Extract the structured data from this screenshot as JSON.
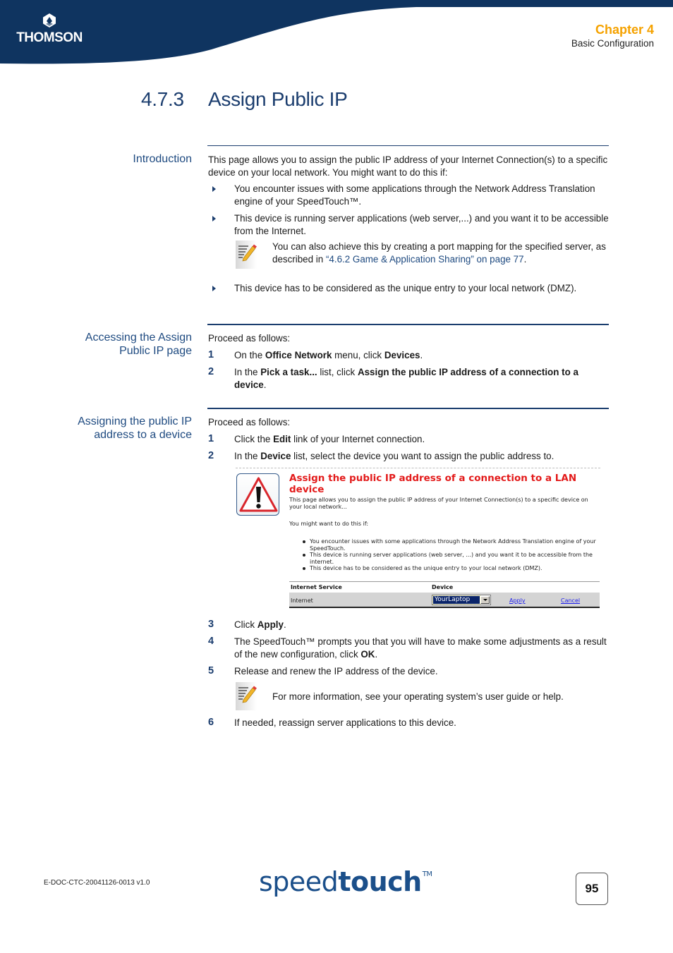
{
  "header": {
    "brand": "THOMSON",
    "chapter_title": "Chapter 4",
    "chapter_subtitle": "Basic Configuration",
    "colors": {
      "band": "#0f3460",
      "chapter_accent": "#f5a200",
      "heading": "#1b3d6e"
    }
  },
  "page_title": {
    "number": "4.7.3",
    "text": "Assign Public IP"
  },
  "sections": {
    "introduction": {
      "heading": "Introduction",
      "intro": "This page allows you to assign the public IP address of your Internet Connection(s) to a specific device on your local network. You might want to do this if:",
      "bullets": [
        "You encounter issues with some applications through the Network Address Translation engine of your SpeedTouch™.",
        "This device is running server applications (web server,...) and you want it to be accessible from the Internet.",
        "This device has to be considered as the unique entry to your local network (DMZ)."
      ],
      "note": {
        "text_before": "You can also achieve this by creating a port mapping for the specified server, as described in ",
        "link_text": "“4.6.2 Game & Application Sharing” on page 77",
        "text_after": "."
      }
    },
    "accessing": {
      "heading_line1": "Accessing the Assign",
      "heading_line2": "Public IP page",
      "lead": "Proceed as follows:",
      "steps": [
        {
          "num": "1",
          "parts": [
            "On the ",
            "Office Network",
            " menu, click ",
            "Devices",
            "."
          ]
        },
        {
          "num": "2",
          "parts": [
            "In the ",
            "Pick a task...",
            " list, click ",
            "Assign the public IP address of a connection to a device",
            "."
          ]
        }
      ]
    },
    "assigning": {
      "heading_line1": "Assigning the public IP",
      "heading_line2": "address to a device",
      "lead": "Proceed as follows:",
      "steps": [
        {
          "num": "1",
          "parts": [
            "Click the ",
            "Edit",
            " link of your Internet connection."
          ]
        },
        {
          "num": "2",
          "parts": [
            "In the ",
            "Device",
            " list, select the device you want to assign the public address to."
          ]
        },
        {
          "num": "3",
          "parts": [
            "Click ",
            "Apply",
            "."
          ]
        },
        {
          "num": "4",
          "parts": [
            "The SpeedTouch™ prompts you that you will have to make some adjustments as a result of the new configuration, click ",
            "OK",
            "."
          ]
        },
        {
          "num": "5",
          "parts": [
            "Release and renew the IP address of the device."
          ]
        },
        {
          "num": "6",
          "parts": [
            "If needed, reassign server applications to this device."
          ]
        }
      ],
      "note": "For more information, see your operating system’s user guide or help."
    }
  },
  "screenshot": {
    "title": "Assign the public IP address of a connection to a LAN device",
    "description": "This page allows you to assign the public IP address of your Internet Connection(s) to a specific device on your local network...",
    "lead": "You might want to do this if:",
    "bullets": [
      "You encounter issues with some applications through the Network Address Translation engine of your SpeedTouch.",
      "This device is running server applications (web server, ...) and you want it to be accessible from the internet.",
      "This device has to be considered as the unique entry to your local network (DMZ)."
    ],
    "table": {
      "col_service": "Internet Service",
      "col_device": "Device",
      "row_service": "Internet",
      "device_selected": "YourLaptop",
      "apply_label": "Apply",
      "cancel_label": "Cancel"
    },
    "colors": {
      "title": "#e31b1b",
      "row_bg": "#d4d4d4",
      "select_highlight": "#0a246a",
      "link": "#1a1aee"
    }
  },
  "footer": {
    "doc_id": "E-DOC-CTC-20041126-0013 v1.0",
    "logo_light": "speed",
    "logo_bold": "touch",
    "logo_tm": "TM",
    "page_number": "95"
  }
}
